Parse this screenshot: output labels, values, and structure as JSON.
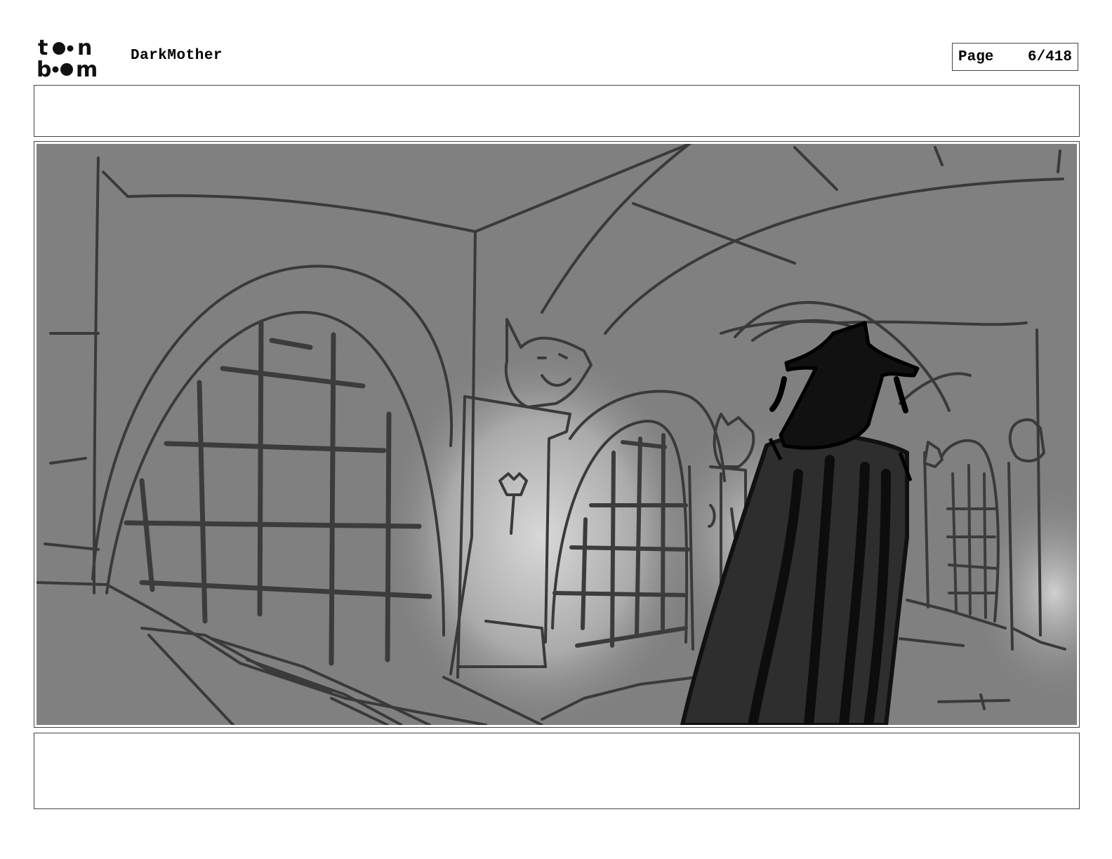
{
  "header": {
    "logo_text": "toon boom",
    "project_title": "DarkMother",
    "page_label": "Page",
    "page_number": "6/418"
  },
  "panel": {
    "colors": {
      "background": "#808080",
      "line": "#3a3a3a",
      "glow": "#d6d6d6",
      "figure": "#111111",
      "cloak": "#2e2e2e"
    }
  },
  "notes": {
    "top": "",
    "bottom": ""
  }
}
